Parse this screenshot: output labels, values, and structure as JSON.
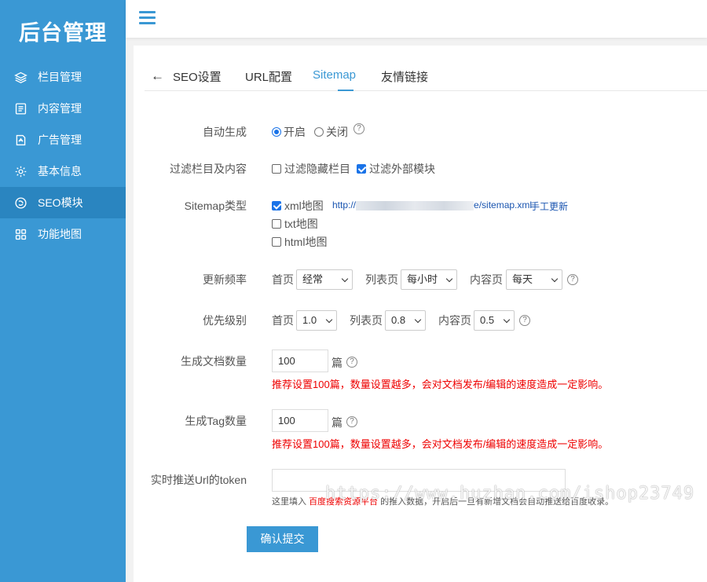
{
  "sidebar": {
    "logo": "后台管理",
    "items": [
      {
        "label": "栏目管理",
        "icon": "layers-icon"
      },
      {
        "label": "内容管理",
        "icon": "document-icon"
      },
      {
        "label": "广告管理",
        "icon": "ad-icon"
      },
      {
        "label": "基本信息",
        "icon": "gear-icon"
      },
      {
        "label": "SEO模块",
        "icon": "seo-icon",
        "active": true
      },
      {
        "label": "功能地图",
        "icon": "grid-icon"
      }
    ]
  },
  "tabs": {
    "back": "←",
    "items": [
      "SEO设置",
      "URL配置",
      "Sitemap",
      "友情链接"
    ],
    "active": "Sitemap"
  },
  "form": {
    "auto": {
      "label": "自动生成",
      "on": "开启",
      "off": "关闭",
      "value": "开启"
    },
    "filter": {
      "label": "过滤栏目及内容",
      "hidden": "过滤隐藏栏目",
      "hidden_checked": false,
      "external": "过滤外部模块",
      "external_checked": true
    },
    "type": {
      "label": "Sitemap类型",
      "xml": "xml地图",
      "xml_checked": true,
      "xml_url_prefix": "http://",
      "xml_url_suffix": "e/sitemap.xml",
      "manual_update": "手工更新",
      "txt": "txt地图",
      "txt_checked": false,
      "html": "html地图",
      "html_checked": false
    },
    "freq": {
      "label": "更新频率",
      "home": "首页",
      "home_value": "经常",
      "list": "列表页",
      "list_value": "每小时",
      "content": "内容页",
      "content_value": "每天"
    },
    "priority": {
      "label": "优先级别",
      "home": "首页",
      "home_value": "1.0",
      "list": "列表页",
      "list_value": "0.8",
      "content": "内容页",
      "content_value": "0.5"
    },
    "doc_count": {
      "label": "生成文档数量",
      "value": "100",
      "unit": "篇",
      "tip": "推荐设置100篇，数量设置越多，会对文档发布/编辑的速度造成一定影响。"
    },
    "tag_count": {
      "label": "生成Tag数量",
      "value": "100",
      "unit": "篇",
      "tip": "推荐设置100篇，数量设置越多，会对文档发布/编辑的速度造成一定影响。"
    },
    "token": {
      "label": "实时推送Url的token",
      "value": "",
      "hint_pre": "这里填入",
      "hint_link": "百度搜索资源平台",
      "hint_post": "的推入数据，开启后一旦有新增文档会自动推送给百度收录。"
    },
    "submit": "确认提交"
  },
  "help_glyph": "?",
  "watermark": "https://www.huzhan.com/ishop23749"
}
